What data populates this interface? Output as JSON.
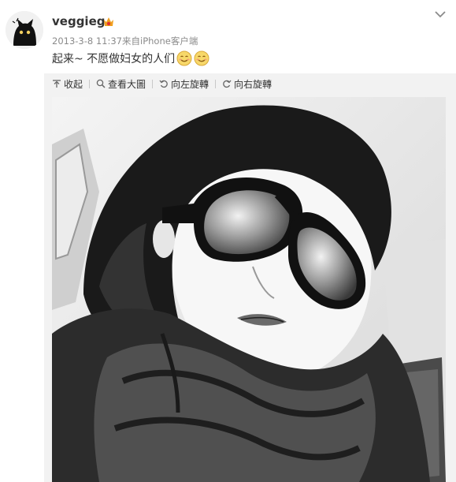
{
  "post": {
    "username": "veggieg",
    "timestamp": "2013-3-8 11:37",
    "source": "来自iPhone客户端",
    "content_text": "起来~ 不愿做妇女的人们",
    "emojis": [
      "smile-emoji",
      "smile-emoji"
    ]
  },
  "toolbar": {
    "collapse_label": "收起",
    "view_large_label": "查看大圖",
    "rotate_left_label": "向左旋轉",
    "rotate_right_label": "向右旋轉"
  },
  "photo": {
    "alt": "",
    "style": "black-and-white selfie"
  },
  "colors": {
    "text": "#333333",
    "meta": "#8b8b8b",
    "toolbar_bg": "#f2f2f2",
    "badge": "#f0a020"
  }
}
